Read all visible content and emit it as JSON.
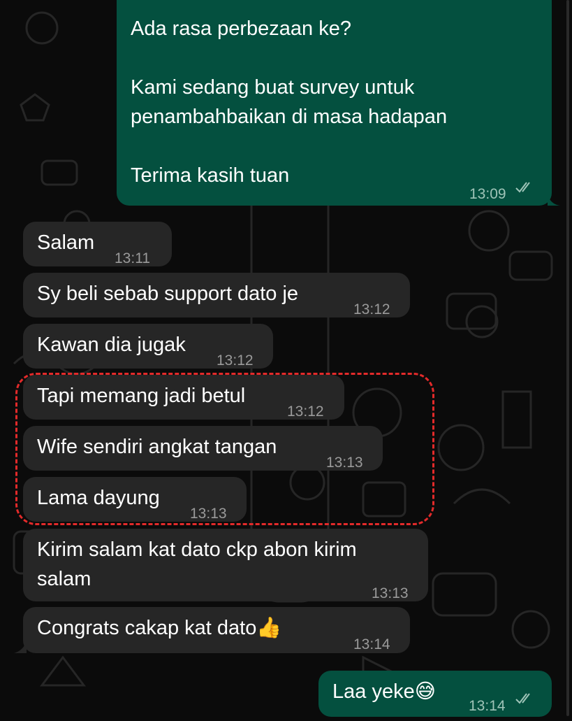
{
  "messages": [
    {
      "direction": "outgoing",
      "text": "Ada rasa perbezaan ke?\n\nKami sedang buat survey untuk penambahbaikan di masa hadapan\n\nTerima kasih tuan",
      "time": "13:09",
      "status": "read-double-check"
    },
    {
      "direction": "incoming",
      "text": "Salam",
      "time": "13:11"
    },
    {
      "direction": "incoming",
      "text": "Sy beli sebab support dato je",
      "time": "13:12"
    },
    {
      "direction": "incoming",
      "text": "Kawan dia jugak",
      "time": "13:12"
    },
    {
      "direction": "incoming",
      "text": "Tapi memang jadi betul",
      "time": "13:12",
      "highlighted": true
    },
    {
      "direction": "incoming",
      "text": "Wife sendiri angkat tangan",
      "time": "13:13",
      "highlighted": true
    },
    {
      "direction": "incoming",
      "text": "Lama dayung",
      "time": "13:13",
      "highlighted": true
    },
    {
      "direction": "incoming",
      "text": "Kirim salam kat dato ckp abon kirim salam",
      "time": "13:13"
    },
    {
      "direction": "incoming",
      "text": "Congrats cakap kat dato👍",
      "time": "13:14"
    },
    {
      "direction": "outgoing",
      "text": "Laa yeke😅",
      "time": "13:14",
      "status": "read-double-check"
    }
  ],
  "colors": {
    "outgoing_bubble": "#04503f",
    "incoming_bubble": "#262626",
    "highlight_border": "#e32a2a",
    "background": "#0b0b0b"
  }
}
